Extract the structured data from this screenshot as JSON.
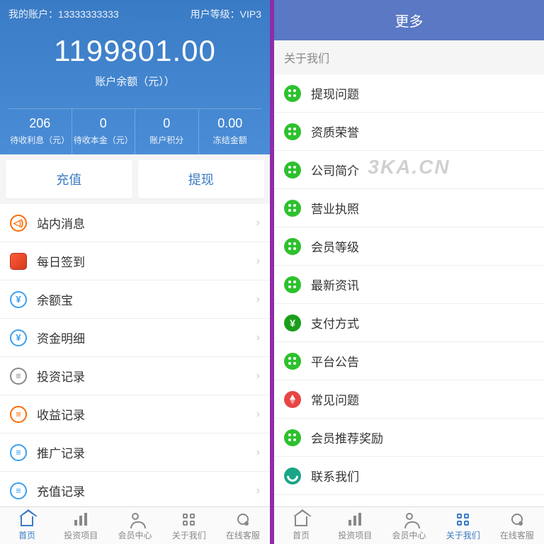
{
  "left": {
    "account_label": "我的账户：",
    "account_value": "13333333333",
    "level_label": "用户等级：",
    "level_value": "VIP3",
    "balance": "1199801.00",
    "balance_label": "账户余额（元））",
    "stats": [
      {
        "value": "206",
        "label": "待收利息（元）"
      },
      {
        "value": "0",
        "label": "待收本金（元）"
      },
      {
        "value": "0",
        "label": "账户积分"
      },
      {
        "value": "0.00",
        "label": "冻结金额"
      }
    ],
    "recharge_btn": "充值",
    "withdraw_btn": "提现",
    "menu": [
      {
        "label": "站内消息",
        "icon": "horn"
      },
      {
        "label": "每日签到",
        "icon": "square"
      },
      {
        "label": "余额宝",
        "icon": "yen-blue"
      },
      {
        "label": "资金明细",
        "icon": "yen-blue"
      },
      {
        "label": "投资记录",
        "icon": "doc-gray"
      },
      {
        "label": "收益记录",
        "icon": "doc-orange"
      },
      {
        "label": "推广记录",
        "icon": "doc-blue"
      },
      {
        "label": "充值记录",
        "icon": "doc-blue"
      }
    ]
  },
  "right": {
    "title": "更多",
    "section": "关于我们",
    "menu": [
      {
        "label": "提现问题",
        "icon": "wechat"
      },
      {
        "label": "资质荣誉",
        "icon": "wechat"
      },
      {
        "label": "公司简介",
        "icon": "wechat"
      },
      {
        "label": "营业执照",
        "icon": "wechat"
      },
      {
        "label": "会员等级",
        "icon": "wechat"
      },
      {
        "label": "最新资讯",
        "icon": "wechat"
      },
      {
        "label": "支付方式",
        "icon": "yen-green"
      },
      {
        "label": "平台公告",
        "icon": "wechat"
      },
      {
        "label": "常见问题",
        "icon": "compass"
      },
      {
        "label": "会员推荐奖励",
        "icon": "wechat"
      },
      {
        "label": "联系我们",
        "icon": "phone"
      }
    ]
  },
  "tabs": [
    {
      "label": "首页",
      "icon": "home"
    },
    {
      "label": "投资项目",
      "icon": "bars"
    },
    {
      "label": "会员中心",
      "icon": "person"
    },
    {
      "label": "关于我们",
      "icon": "grid"
    },
    {
      "label": "在线客服",
      "icon": "headset"
    }
  ],
  "watermark": "3KA.CN"
}
